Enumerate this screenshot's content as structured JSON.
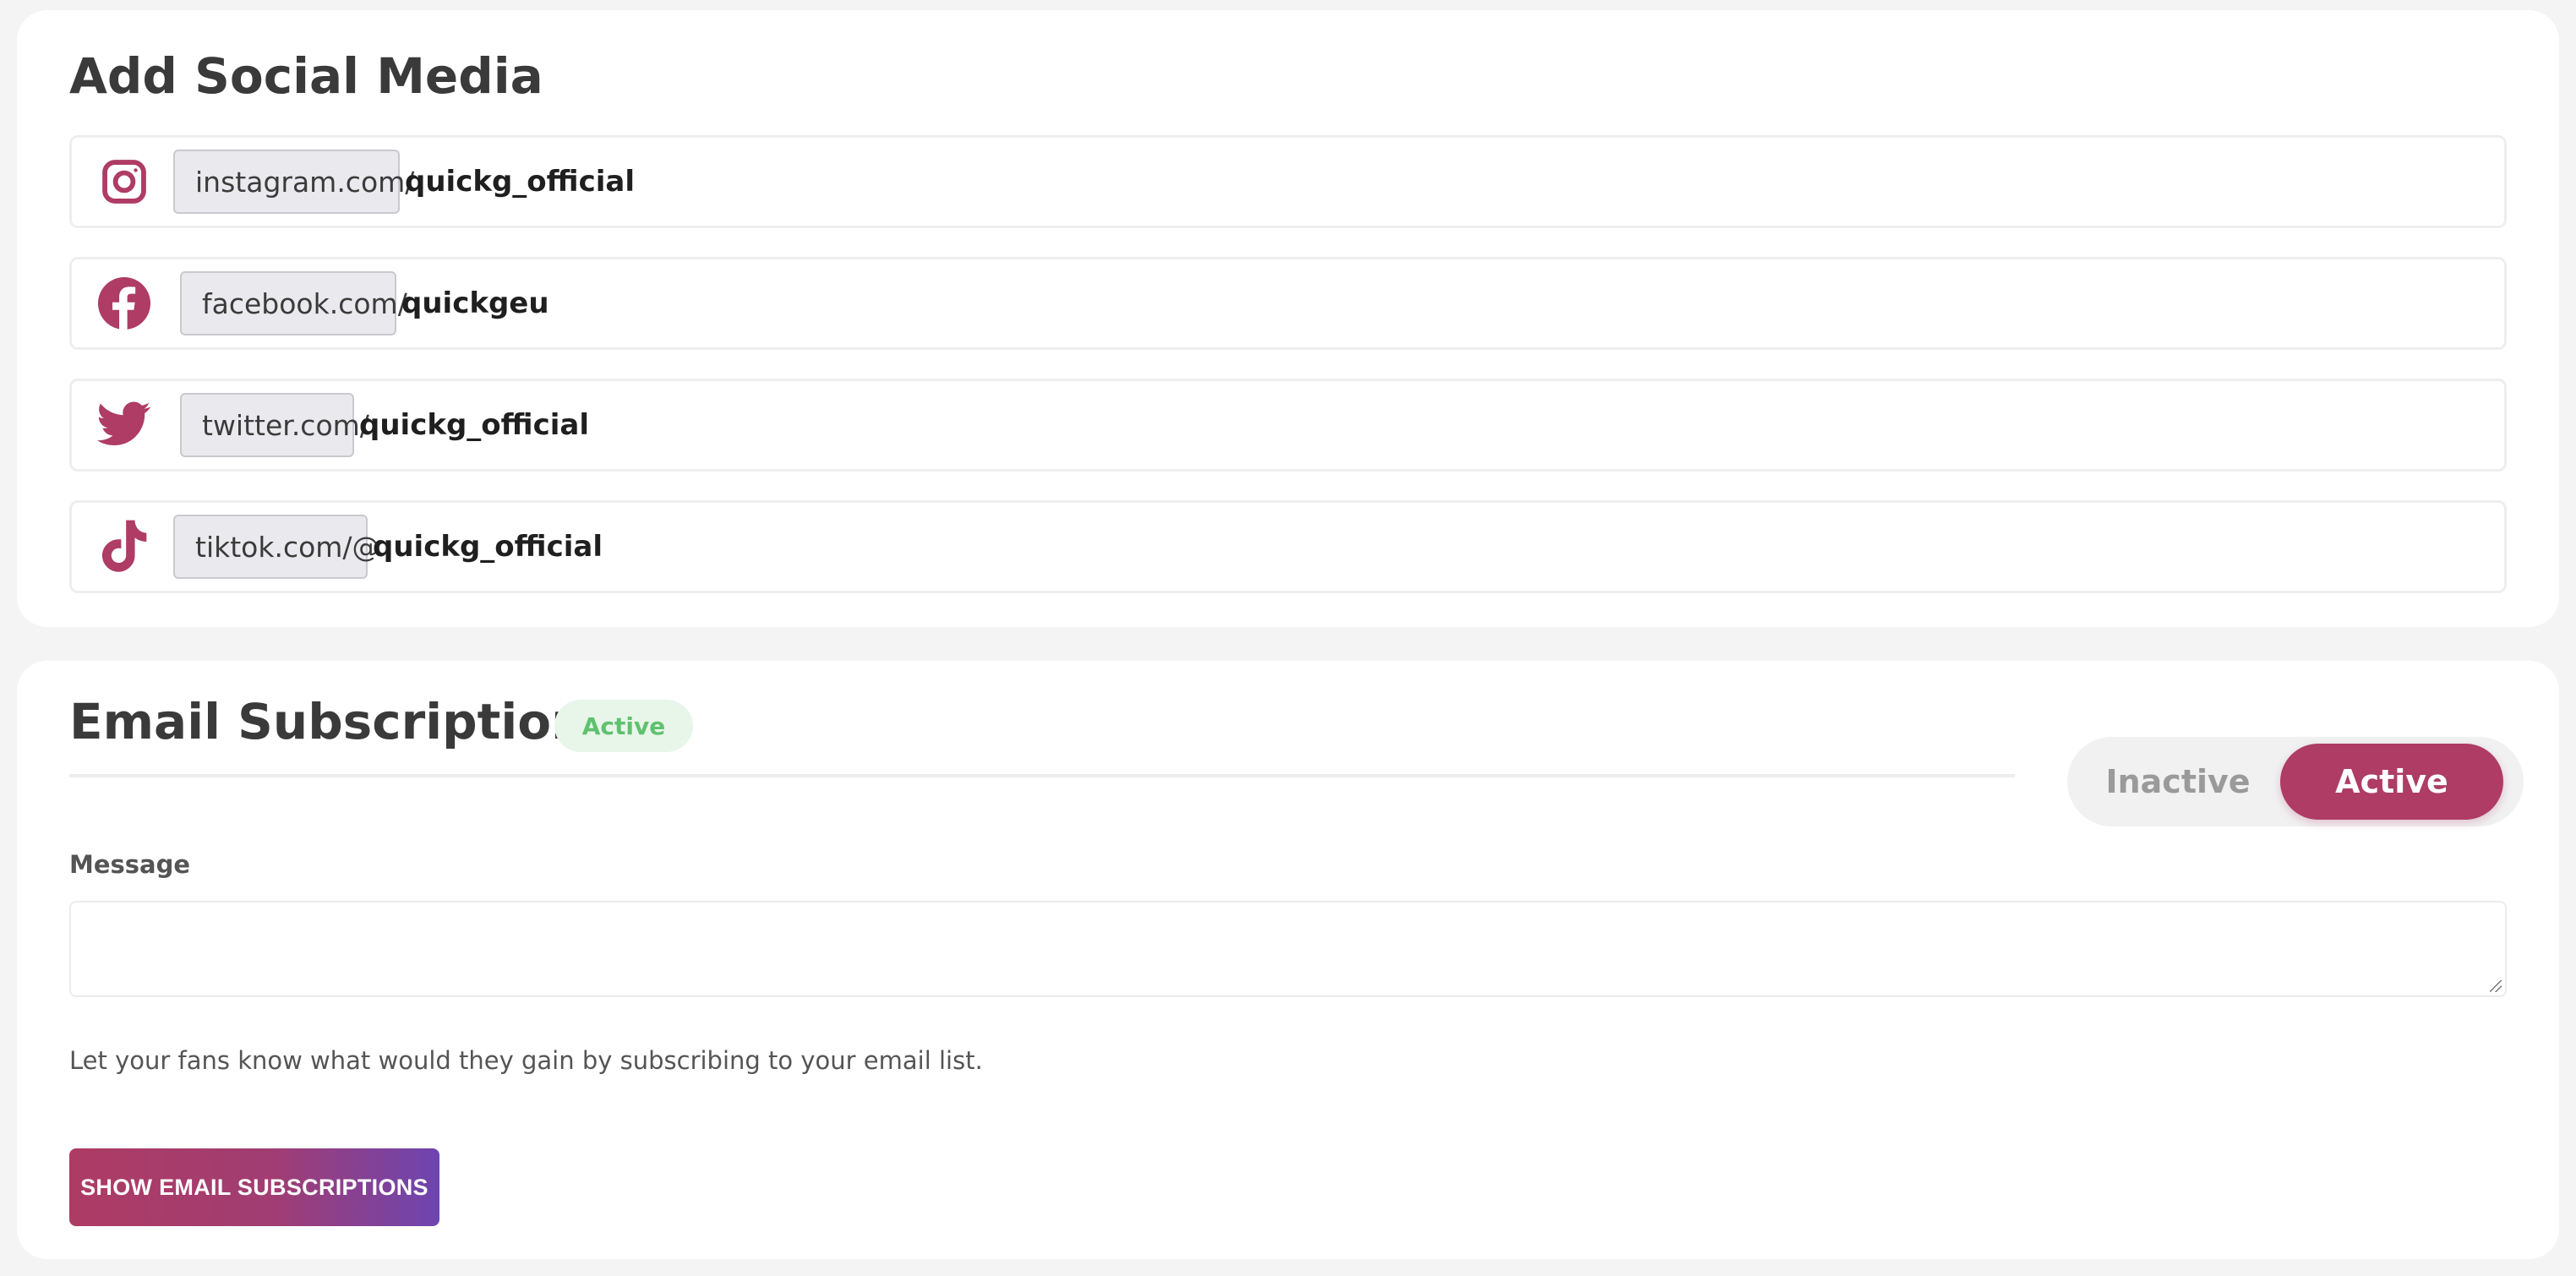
{
  "social": {
    "title": "Add Social Media",
    "icon_color": "#ae3c65",
    "items": [
      {
        "icon": "instagram-icon",
        "prefix": "instagram.com/",
        "username": "quickg_official"
      },
      {
        "icon": "facebook-icon",
        "prefix": "facebook.com/",
        "username": "quickgeu"
      },
      {
        "icon": "twitter-icon",
        "prefix": "twitter.com/",
        "username": "quickg_official"
      },
      {
        "icon": "tiktok-icon",
        "prefix": "tiktok.com/@",
        "username": "quickg_official"
      }
    ]
  },
  "email": {
    "title": "Email Subscription",
    "status_badge": "Active",
    "status_color": "#5fc16f",
    "toggle": {
      "inactive_label": "Inactive",
      "active_label": "Active",
      "selected": "Active"
    },
    "message_label": "Message",
    "message_value": "",
    "help_text": "Let your fans know what would they gain by subscribing to your email list.",
    "button_label": "SHOW EMAIL SUBSCRIPTIONS"
  }
}
